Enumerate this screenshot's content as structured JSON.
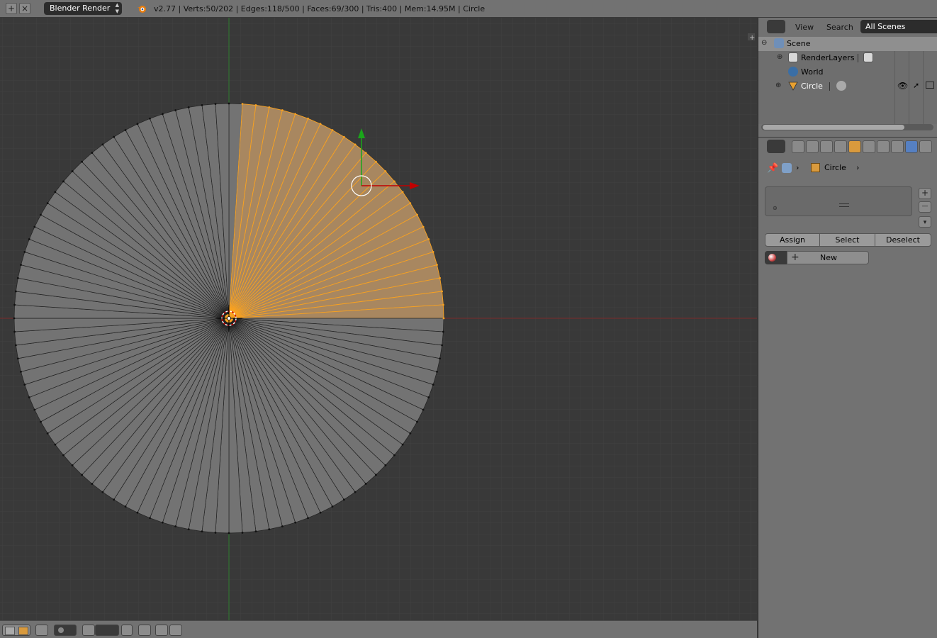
{
  "topbar": {
    "add_icon": "plus-icon",
    "close_icon": "close-icon",
    "render_engine": "Blender Render",
    "stats": "v2.77 | Verts:50/202 | Edges:118/500 | Faces:69/300 | Tris:400 | Mem:14.95M | Circle"
  },
  "outliner": {
    "menu_view": "View",
    "menu_search": "Search",
    "scenes_filter": "All Scenes",
    "items": [
      {
        "label": "Scene"
      },
      {
        "label": "RenderLayers"
      },
      {
        "label": "World"
      },
      {
        "label": "Circle"
      }
    ]
  },
  "properties": {
    "breadcrumb_object": "Circle",
    "slot_add": "+",
    "slot_remove": "—",
    "assign_label": "Assign",
    "select_label": "Select",
    "deselect_label": "Deselect",
    "new_label": "New"
  },
  "colors": {
    "accent_selected": "#f7a121",
    "x_axis": "#c10000",
    "y_axis": "#1aa51a",
    "viewport_bg": "#393939",
    "mesh_face": "#737373"
  }
}
